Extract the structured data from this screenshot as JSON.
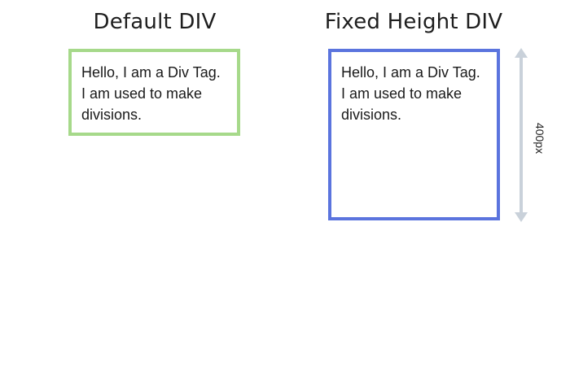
{
  "default_column": {
    "title": "Default DIV",
    "box_text": "Hello, I am a Div Tag. I am used to make divisions.",
    "border_color": "#a6d98a"
  },
  "fixed_column": {
    "title": "Fixed Height DIV",
    "box_text": "Hello, I am a Div Tag. I am used to make divisions.",
    "border_color": "#5b74de"
  },
  "height_indicator": {
    "label": "400px",
    "color": "#c9d1da"
  }
}
